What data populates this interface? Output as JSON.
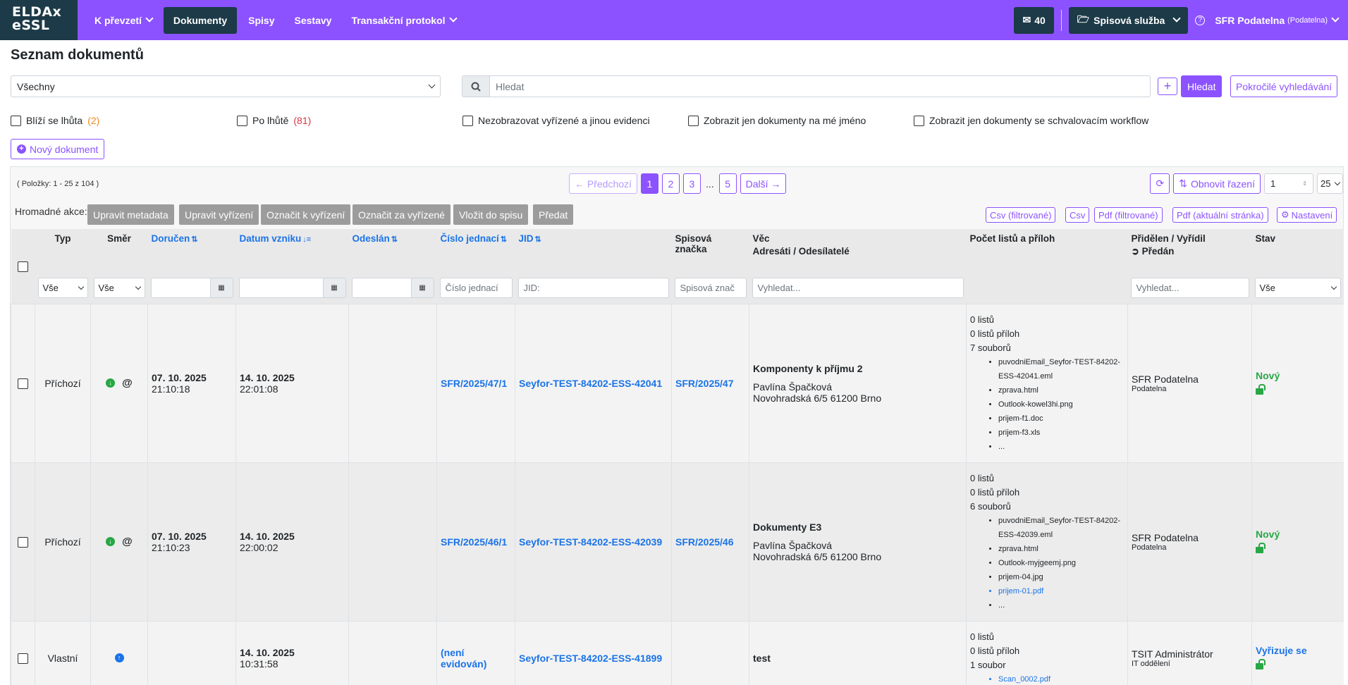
{
  "logo": {
    "line1": "ELDAx",
    "line2": "eSSL"
  },
  "nav": {
    "items": [
      {
        "label": "K převzetí",
        "dropdown": true,
        "active": false
      },
      {
        "label": "Dokumenty",
        "dropdown": false,
        "active": true
      },
      {
        "label": "Spisy",
        "dropdown": false,
        "active": false
      },
      {
        "label": "Sestavy",
        "dropdown": false,
        "active": false
      },
      {
        "label": "Transakční protokol",
        "dropdown": true,
        "active": false
      }
    ],
    "mail_count": "40",
    "spisova_sluzba": "Spisová služba",
    "user_name": "SFR Podatelna",
    "user_role": "(Podatelna)"
  },
  "page_title": "Seznam dokumentů",
  "scope_select": "Všechny",
  "search": {
    "placeholder": "Hledat",
    "button": "Hledat",
    "advanced": "Pokročilé vyhledávání"
  },
  "filters": [
    {
      "label": "Blíží se lhůta",
      "count": "(2)",
      "color": "#f08a24"
    },
    {
      "label": "Po lhůtě",
      "count": "(81)",
      "color": "#dc3545"
    },
    {
      "label": "Nezobrazovat vyřízené a jinou evidenci",
      "count": ""
    },
    {
      "label": "Zobrazit jen dokumenty na mé jméno",
      "count": ""
    },
    {
      "label": "Zobrazit jen dokumenty se schvalovacím workflow",
      "count": ""
    }
  ],
  "new_document": "Nový dokument",
  "items_info": "( Položky: 1 - 25 z 104 )",
  "pager": {
    "prev": "← Předchozí",
    "pages": [
      "1",
      "2",
      "3"
    ],
    "dots": "...",
    "last": "5",
    "next": "Další →"
  },
  "tools": {
    "reset_sort": "Obnovit řazení",
    "page_input": "1",
    "page_size": "25"
  },
  "bulk": {
    "label": "Hromadné akce:",
    "actions": [
      "Upravit metadata",
      "Upravit vyřízení",
      "Označit k vyřízení",
      "Označit za vyřízené",
      "Vložit do spisu",
      "Předat"
    ]
  },
  "exports": [
    "Csv (filtrované)",
    "Csv",
    "Pdf (filtrované)",
    "Pdf (aktuální stránka)",
    "Nastavení"
  ],
  "columns": {
    "typ": "Typ",
    "smer": "Směr",
    "doruceno": "Doručen",
    "datum_vzniku": "Datum vzniku",
    "odeslan": "Odeslán",
    "cislo_jednaci": "Číslo jednací",
    "jid": "JID",
    "spisova_znacka": "Spisová značka",
    "vec": "Věc",
    "vec_sub": "Adresáti / Odesílatelé",
    "pocet": "Počet listů a příloh",
    "pridelen": "Přidělen / Vyřídil",
    "predan": "Předán",
    "stav": "Stav"
  },
  "column_filters": {
    "typ": "Vše",
    "smer": "Vše",
    "cislo_jednaci": "Číslo jednací",
    "jid": "JID:",
    "spisova_znacka": "Spisová znač",
    "vec": "Vyhledat...",
    "pridelen": "Vyhledat...",
    "stav": "Vše"
  },
  "rows": [
    {
      "typ": "Příchozí",
      "smer": "in",
      "doruceno_date": "07. 10. 2025",
      "doruceno_time": "21:10:18",
      "vznik_date": "14. 10. 2025",
      "vznik_time": "22:01:08",
      "cislo_jednaci": "SFR/2025/47/1",
      "jid": "Seyfor-TEST-84202-ESS-42041",
      "spisova_znacka": "SFR/2025/47",
      "vec": "Komponenty k příjmu 2",
      "adresat": "Pavlína Špačková",
      "adresa": "Novohradská 6/5 61200 Brno",
      "listu": "0 listů",
      "priloh": "0 listů příloh",
      "souboru": "7 souborů",
      "files": [
        "puvodniEmail_Seyfor-TEST-84202-ESS-42041.eml",
        "zprava.html",
        "Outlook-kowel3hi.png",
        "prijem-f1.doc",
        "prijem-f3.xls",
        "..."
      ],
      "pridelen": "SFR Podatelna",
      "pridelen_sub": "Podatelna",
      "stav": "Nový"
    },
    {
      "typ": "Příchozí",
      "smer": "in",
      "doruceno_date": "07. 10. 2025",
      "doruceno_time": "21:10:23",
      "vznik_date": "14. 10. 2025",
      "vznik_time": "22:00:02",
      "cislo_jednaci": "SFR/2025/46/1",
      "jid": "Seyfor-TEST-84202-ESS-42039",
      "spisova_znacka": "SFR/2025/46",
      "vec": "Dokumenty E3",
      "adresat": "Pavlína Špačková",
      "adresa": "Novohradská 6/5 61200 Brno",
      "listu": "0 listů",
      "priloh": "0 listů příloh",
      "souboru": "6 souborů",
      "files": [
        "puvodniEmail_Seyfor-TEST-84202-ESS-42039.eml",
        "zprava.html",
        "Outlook-myjgeemj.png",
        "prijem-04.jpg",
        "prijem-01.pdf",
        "..."
      ],
      "pridelen": "SFR Podatelna",
      "pridelen_sub": "Podatelna",
      "stav": "Nový"
    },
    {
      "typ": "Vlastní",
      "smer": "own",
      "doruceno_date": "",
      "doruceno_time": "",
      "vznik_date": "14. 10. 2025",
      "vznik_time": "10:31:58",
      "cislo_jednaci": "(není evidován)",
      "jid": "Seyfor-TEST-84202-ESS-41899",
      "spisova_znacka": "",
      "vec": "test",
      "adresat": "",
      "adresa": "",
      "listu": "0 listů",
      "priloh": "0 listů příloh",
      "souboru": "1 soubor",
      "files": [
        "Scan_0002.pdf"
      ],
      "pridelen": "TSIT Administrátor",
      "pridelen_sub": "IT oddělení",
      "stav": "Vyřizuje se"
    }
  ],
  "colors": {
    "brand": "#8c52ff",
    "dark": "#1c3a47",
    "link": "#1a73e8",
    "ok": "#28a745"
  }
}
